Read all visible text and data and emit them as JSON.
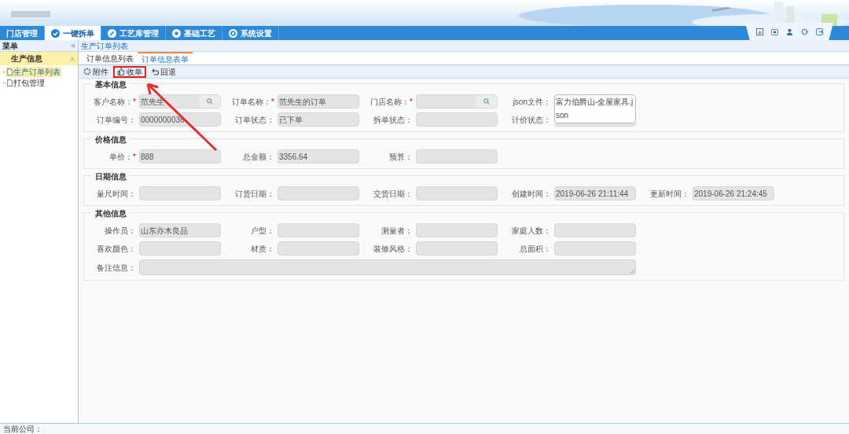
{
  "nav_tabs": [
    {
      "label": "门店管理",
      "selected": false
    },
    {
      "label": "一键拆单",
      "selected": true
    },
    {
      "label": "工艺库管理",
      "selected": false
    },
    {
      "label": "基础工艺",
      "selected": false
    },
    {
      "label": "系统设置",
      "selected": false
    }
  ],
  "sidebar": {
    "title": "菜单",
    "collapse": "«",
    "group": {
      "label": "生产信息",
      "expanded": true
    },
    "items": [
      {
        "label": "生产订单列表",
        "selected": true
      },
      {
        "label": "打包管理",
        "selected": false
      }
    ]
  },
  "breadcrumb": "生产订单列表",
  "tabs": [
    {
      "label": "订单信息列表",
      "selected": false
    },
    {
      "label": "订单信息表单",
      "selected": true
    }
  ],
  "toolbar": [
    {
      "label": "附件",
      "highlighted": false
    },
    {
      "label": "收单",
      "highlighted": true
    },
    {
      "label": "回退",
      "highlighted": false
    }
  ],
  "sections": [
    {
      "title": "基本信息",
      "rows": [
        [
          {
            "label": "客户名称：",
            "required_mark": "*",
            "kind": "search",
            "value": "范先生"
          },
          {
            "label": "订单名称：",
            "required_mark": "*",
            "kind": "text",
            "value": "范先生的订单"
          },
          {
            "label": "门店名称：",
            "required_mark": "*",
            "kind": "search"
          },
          {
            "label": "json文件：",
            "kind": "file",
            "value": "富力伯爵山-全屋家具.json"
          }
        ],
        [
          {
            "label": "订单编号：",
            "kind": "text",
            "value": "0000000036"
          },
          {
            "label": "订单状态：",
            "kind": "text",
            "value": "已下单"
          },
          {
            "label": "拆单状态：",
            "kind": "text"
          },
          {
            "label": "计价状态：",
            "kind": "partial"
          }
        ]
      ]
    },
    {
      "title": "价格信息",
      "rows": [
        [
          {
            "label": "单价：",
            "required_mark": "*",
            "kind": "text",
            "value": "888"
          },
          {
            "label": "总金额：",
            "kind": "text",
            "value": "3356.64"
          },
          {
            "label": "预算：",
            "kind": "text"
          }
        ]
      ]
    },
    {
      "title": "日期信息",
      "rows": [
        [
          {
            "label": "量尺时间：",
            "kind": "text"
          },
          {
            "label": "订货日期：",
            "kind": "text"
          },
          {
            "label": "交货日期：",
            "kind": "text"
          },
          {
            "label": "创建时间：",
            "kind": "text",
            "value": "2019-06-26 21:11:44"
          },
          {
            "label": "更新时间：",
            "kind": "text",
            "value": "2019-06-26 21:24:45"
          }
        ]
      ]
    },
    {
      "title": "其他信息",
      "rows": [
        [
          {
            "label": "操作员：",
            "kind": "text",
            "value": "山东亦木良品"
          },
          {
            "label": "户型：",
            "kind": "text"
          },
          {
            "label": "测量者：",
            "kind": "text"
          },
          {
            "label": "家庭人数：",
            "kind": "text"
          }
        ],
        [
          {
            "label": "喜欢颜色：",
            "kind": "text"
          },
          {
            "label": "材质：",
            "kind": "text"
          },
          {
            "label": "装修风格：",
            "kind": "text"
          },
          {
            "label": "总面积：",
            "kind": "text"
          }
        ],
        [
          {
            "label": "备注信息：",
            "kind": "textarea"
          }
        ]
      ]
    }
  ],
  "status_bar": "当前公司："
}
